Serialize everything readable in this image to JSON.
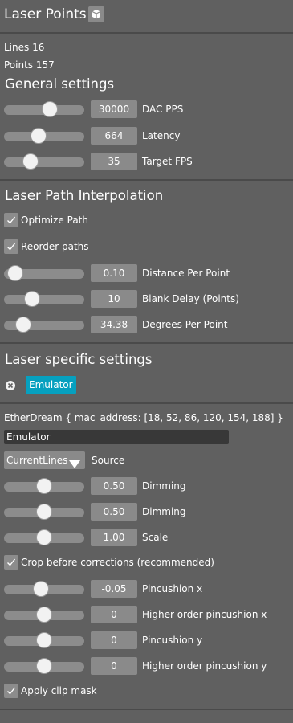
{
  "header": {
    "title": "Laser Points",
    "icon": "cube-icon"
  },
  "stats": {
    "lines": "Lines 16",
    "points": "Points 157"
  },
  "general": {
    "title": "General settings",
    "sliders": [
      {
        "id": "dac-pps",
        "value": "30000",
        "label": "DAC PPS",
        "fraction": 0.57
      },
      {
        "id": "latency",
        "value": "664",
        "label": "Latency",
        "fraction": 0.43
      },
      {
        "id": "target-fps",
        "value": "35",
        "label": "Target FPS",
        "fraction": 0.33
      }
    ]
  },
  "interpolation": {
    "title": "Laser Path Interpolation",
    "checkboxes": [
      {
        "id": "optimize-path",
        "label": "Optimize Path",
        "checked": true
      },
      {
        "id": "reorder-paths",
        "label": "Reorder paths",
        "checked": true
      }
    ],
    "sliders": [
      {
        "id": "distance-per-point",
        "value": "0.10",
        "label": "Distance Per Point",
        "fraction": 0.14
      },
      {
        "id": "blank-delay",
        "value": "10",
        "label": "Blank Delay (Points)",
        "fraction": 0.35
      },
      {
        "id": "degrees-per-point",
        "value": "34.38",
        "label": "Degrees Per Point",
        "fraction": 0.24
      }
    ]
  },
  "laser_specific": {
    "title": "Laser specific settings",
    "chip": "Emulator"
  },
  "device": {
    "info": "EtherDream { mac_address: [18, 52, 86, 120, 154, 188] }",
    "name_value": "Emulator",
    "source_selected": "CurrentLines",
    "source_label": "Source",
    "sliders_a": [
      {
        "id": "dimming-1",
        "value": "0.50",
        "label": "Dimming",
        "fraction": 0.5
      },
      {
        "id": "dimming-2",
        "value": "0.50",
        "label": "Dimming",
        "fraction": 0.5
      },
      {
        "id": "scale",
        "value": "1.00",
        "label": "Scale",
        "fraction": 0.5
      }
    ],
    "crop_checkbox": {
      "label": "Crop before corrections (recommended)",
      "checked": true
    },
    "sliders_b": [
      {
        "id": "pincushion-x",
        "value": "-0.05",
        "label": "Pincushion x",
        "fraction": 0.46
      },
      {
        "id": "higher-pincushion-x",
        "value": "0",
        "label": "Higher order pincushion x",
        "fraction": 0.5
      },
      {
        "id": "pincushion-y",
        "value": "0",
        "label": "Pincushion y",
        "fraction": 0.5
      },
      {
        "id": "higher-pincushion-y",
        "value": "0",
        "label": "Higher order pincushion y",
        "fraction": 0.5
      }
    ],
    "clip_checkbox": {
      "label": "Apply clip mask",
      "checked": true
    }
  },
  "colors": {
    "panel": "#606060",
    "control": "#8a8a8a",
    "accent": "#06a0bf",
    "rule": "#4a4a4a",
    "input": "#383838"
  }
}
